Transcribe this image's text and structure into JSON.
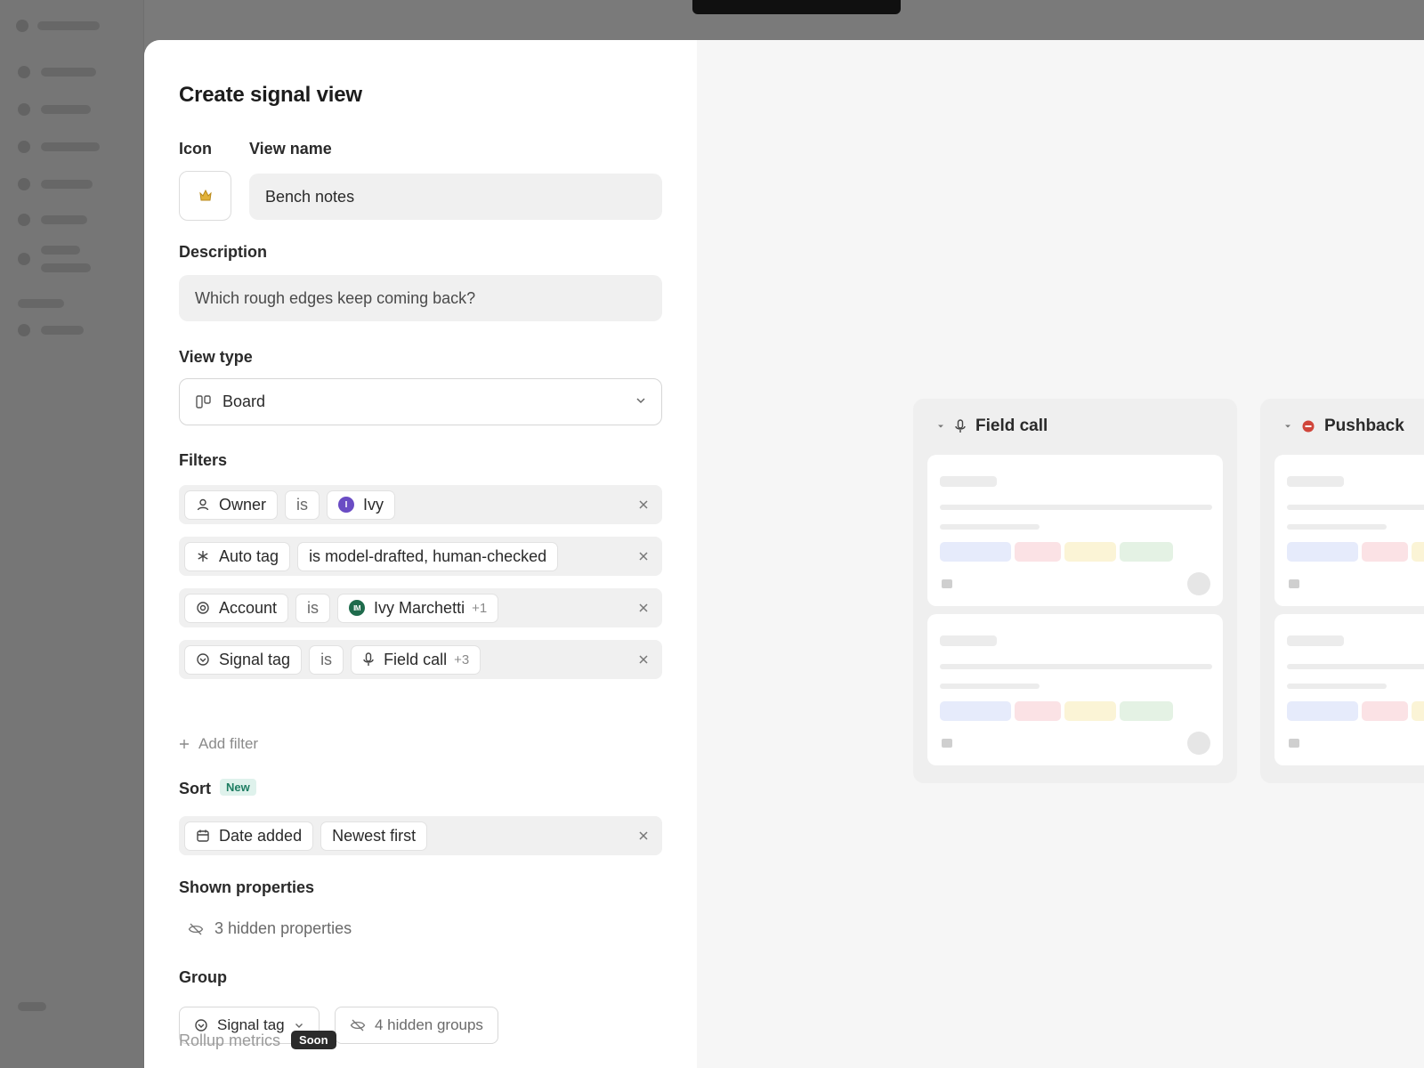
{
  "modal": {
    "title": "Create signal view",
    "icon_label": "Icon",
    "name_label": "View name",
    "name_value": "Bench notes",
    "description_label": "Description",
    "description_value": "Which rough edges keep coming back?",
    "view_type_label": "View type",
    "view_type_value": "Board",
    "filters_label": "Filters",
    "filters": [
      {
        "field": "Owner",
        "op": "is",
        "value": "Ivy",
        "avatar": "I"
      },
      {
        "field": "Auto tag",
        "value": "is model-drafted, human-checked"
      },
      {
        "field": "Account",
        "op": "is",
        "value": "Ivy Marchetti",
        "avatar": "IM",
        "extra": "+1"
      },
      {
        "field": "Signal tag",
        "op": "is",
        "value": "Field call",
        "extra": "+3"
      }
    ],
    "add_filter": "Add filter",
    "sort_label": "Sort",
    "sort_badge": "New",
    "sort": {
      "field": "Date added",
      "order": "Newest first"
    },
    "shown_properties_label": "Shown properties",
    "hidden_properties": "3 hidden properties",
    "group_label": "Group",
    "group_by": "Signal tag",
    "hidden_groups": "4 hidden groups",
    "rollup_label": "Rollup metrics",
    "rollup_badge": "Soon"
  },
  "preview": {
    "columns": [
      {
        "title": "Field call",
        "icon": "mic-icon"
      },
      {
        "title": "Pushback",
        "icon": "stop-icon"
      }
    ],
    "tag_colors": [
      "#e6ebfb",
      "#fbe2e5",
      "#fbf4d6",
      "#e4f2e4"
    ]
  },
  "colors": {
    "accent_purple": "#6a4cc4",
    "account_green": "#1f6b4c",
    "pushback_red": "#d0453a",
    "badge_new_bg": "#dff2ec",
    "badge_new_text": "#1e7d62"
  }
}
